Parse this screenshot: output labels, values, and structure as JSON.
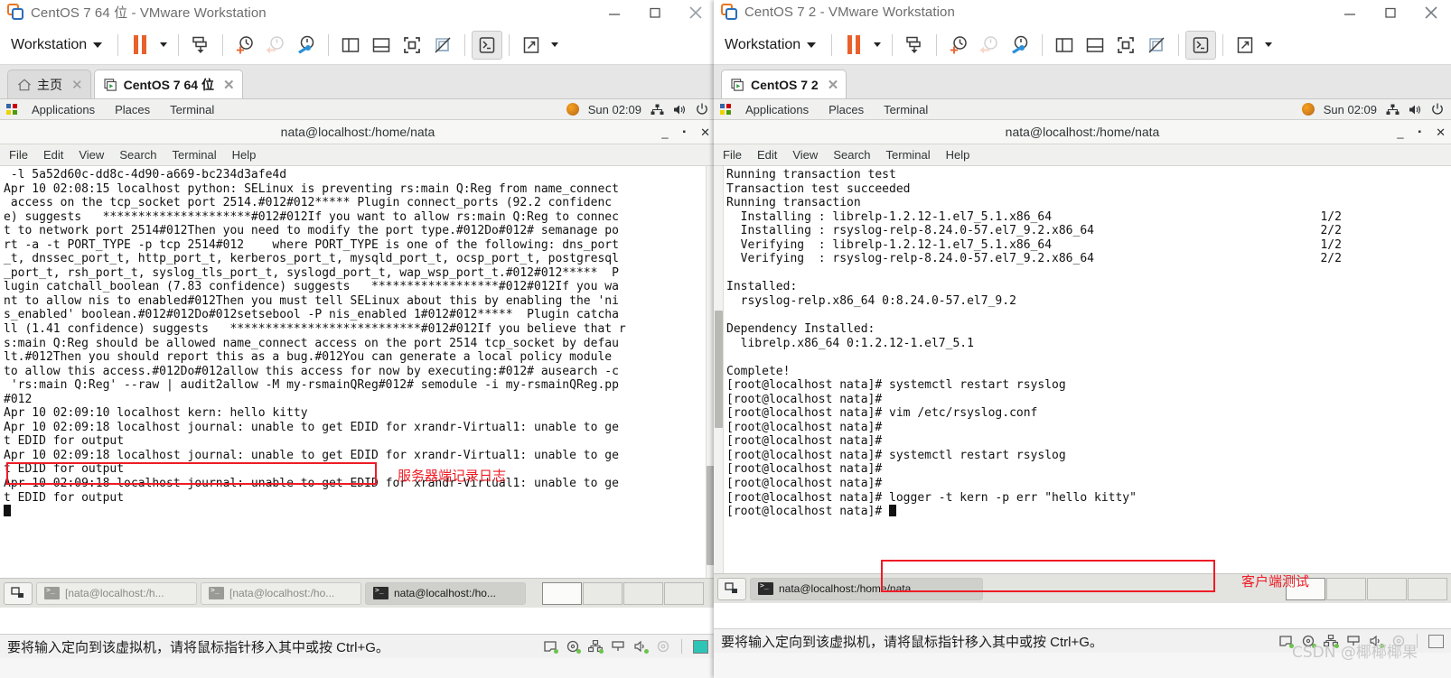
{
  "windows": {
    "left": {
      "title": "CentOS 7 64 位 - VMware Workstation",
      "toolbar": {
        "workstation_label": "Workstation"
      },
      "tabs": [
        {
          "label": "主页",
          "icon": "home-icon",
          "active": false
        },
        {
          "label": "CentOS 7 64 位",
          "icon": "vm-tab-icon",
          "active": true
        }
      ],
      "guest": {
        "menus": [
          "Applications",
          "Places",
          "Terminal"
        ],
        "clock": "Sun 02:09",
        "terminal": {
          "title": "nata@localhost:/home/nata",
          "menus": [
            "File",
            "Edit",
            "View",
            "Search",
            "Terminal",
            "Help"
          ],
          "lines": [
            " -l 5a52d60c-dd8c-4d90-a669-bc234d3afe4d",
            "Apr 10 02:08:15 localhost python: SELinux is preventing rs:main Q:Reg from name_connect",
            " access on the tcp_socket port 2514.#012#012***** Plugin connect_ports (92.2 confidenc",
            "e) suggests   *********************#012#012If you want to allow rs:main Q:Reg to connec",
            "t to network port 2514#012Then you need to modify the port type.#012Do#012# semanage po",
            "rt -a -t PORT_TYPE -p tcp 2514#012    where PORT_TYPE is one of the following: dns_port",
            "_t, dnssec_port_t, http_port_t, kerberos_port_t, mysqld_port_t, ocsp_port_t, postgresql",
            "_port_t, rsh_port_t, syslog_tls_port_t, syslogd_port_t, wap_wsp_port_t.#012#012*****  P",
            "lugin catchall_boolean (7.83 confidence) suggests   ******************#012#012If you wa",
            "nt to allow nis to enabled#012Then you must tell SELinux about this by enabling the 'ni",
            "s_enabled' boolean.#012#012Do#012setsebool -P nis_enabled 1#012#012*****  Plugin catcha",
            "ll (1.41 confidence) suggests   ***************************#012#012If you believe that r",
            "s:main Q:Reg should be allowed name_connect access on the port 2514 tcp_socket by defau",
            "lt.#012Then you should report this as a bug.#012You can generate a local policy module",
            "to allow this access.#012Do#012allow this access for now by executing:#012# ausearch -c",
            " 'rs:main Q:Reg' --raw | audit2allow -M my-rsmainQReg#012# semodule -i my-rsmainQReg.pp",
            "#012",
            "Apr 10 02:09:10 localhost kern: hello kitty",
            "Apr 10 02:09:18 localhost journal: unable to get EDID for xrandr-Virtual1: unable to ge",
            "t EDID for output",
            "Apr 10 02:09:18 localhost journal: unable to get EDID for xrandr-Virtual1: unable to ge",
            "t EDID for output",
            "Apr 10 02:09:18 localhost journal: unable to get EDID for xrandr-Virtual1: unable to ge",
            "t EDID for output"
          ]
        },
        "taskbar": [
          {
            "label": "[nata@localhost:/h...",
            "active": false
          },
          {
            "label": "[nata@localhost:/ho...",
            "active": false
          },
          {
            "label": "nata@localhost:/ho...",
            "active": true
          }
        ]
      },
      "status": "要将输入定向到该虚拟机，请将鼠标指针移入其中或按 Ctrl+G。"
    },
    "right": {
      "title": "CentOS 7 2 - VMware Workstation",
      "toolbar": {
        "workstation_label": "Workstation"
      },
      "tabs": [
        {
          "label": "CentOS 7 2",
          "icon": "vm-tab-icon",
          "active": true
        }
      ],
      "guest": {
        "menus": [
          "Applications",
          "Places",
          "Terminal"
        ],
        "clock": "Sun 02:09",
        "terminal": {
          "title": "nata@localhost:/home/nata",
          "menus": [
            "File",
            "Edit",
            "View",
            "Search",
            "Terminal",
            "Help"
          ],
          "lines": [
            "Running transaction test",
            "Transaction test succeeded",
            "Running transaction",
            "  Installing : librelp-1.2.12-1.el7_5.1.x86_64                                      1/2",
            "  Installing : rsyslog-relp-8.24.0-57.el7_9.2.x86_64                                2/2",
            "  Verifying  : librelp-1.2.12-1.el7_5.1.x86_64                                      1/2",
            "  Verifying  : rsyslog-relp-8.24.0-57.el7_9.2.x86_64                                2/2",
            "",
            "Installed:",
            "  rsyslog-relp.x86_64 0:8.24.0-57.el7_9.2",
            "",
            "Dependency Installed:",
            "  librelp.x86_64 0:1.2.12-1.el7_5.1",
            "",
            "Complete!",
            "[root@localhost nata]# systemctl restart rsyslog",
            "[root@localhost nata]#",
            "[root@localhost nata]# vim /etc/rsyslog.conf",
            "[root@localhost nata]#",
            "[root@localhost nata]#",
            "[root@localhost nata]# systemctl restart rsyslog",
            "[root@localhost nata]#",
            "[root@localhost nata]#",
            "[root@localhost nata]# logger -t kern -p err \"hello kitty\"",
            "[root@localhost nata]#"
          ]
        },
        "taskbar": [
          {
            "label": "nata@localhost:/home/nata",
            "active": true
          }
        ]
      },
      "status": "要将输入定向到该虚拟机，请将鼠标指针移入其中或按 Ctrl+G。"
    }
  },
  "annotations": {
    "server_label": "服务器端记录日志",
    "client_label": "客户端测试",
    "accent_color": "#ee1c25"
  },
  "watermark": "CSDN @椰椰椰果"
}
